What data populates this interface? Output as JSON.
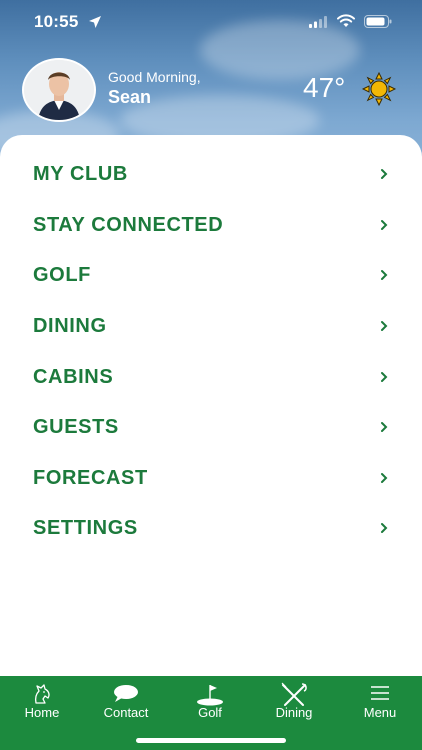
{
  "status_bar": {
    "time": "10:55"
  },
  "header": {
    "greeting": "Good Morning,",
    "name": "Sean",
    "temperature": "47°",
    "weather_icon": "sun-icon"
  },
  "menu": {
    "items": [
      {
        "label": "MY CLUB"
      },
      {
        "label": "STAY CONNECTED"
      },
      {
        "label": "GOLF"
      },
      {
        "label": "DINING"
      },
      {
        "label": "CABINS"
      },
      {
        "label": "GUESTS"
      },
      {
        "label": "FORECAST"
      },
      {
        "label": "SETTINGS"
      }
    ]
  },
  "tabbar": {
    "tabs": [
      {
        "label": "Home",
        "icon": "horse-head-icon"
      },
      {
        "label": "Contact",
        "icon": "chat-bubble-icon"
      },
      {
        "label": "Golf",
        "icon": "golf-flag-icon"
      },
      {
        "label": "Dining",
        "icon": "fork-knife-icon"
      },
      {
        "label": "Menu",
        "icon": "hamburger-menu-icon"
      }
    ]
  },
  "colors": {
    "accent_green": "#1c7a3c",
    "tabbar_green": "#1c8a3e",
    "sun_yellow": "#f2b705"
  }
}
